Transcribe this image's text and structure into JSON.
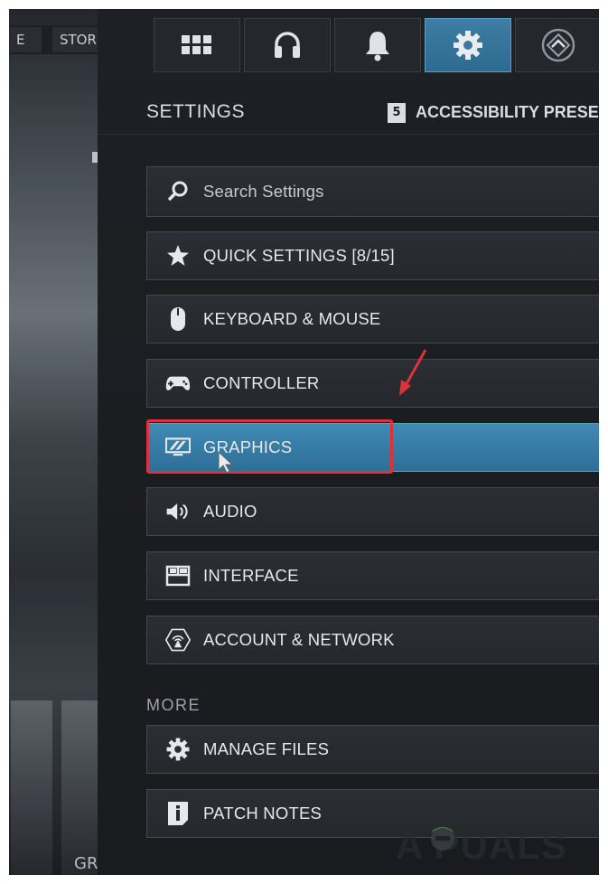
{
  "background": {
    "tabs": [
      "E",
      "STOR"
    ],
    "bottom_text": "GR"
  },
  "top_tabs": [
    {
      "icon": "grid-icon",
      "active": false
    },
    {
      "icon": "headset-icon",
      "active": false
    },
    {
      "icon": "bell-icon",
      "active": false
    },
    {
      "icon": "gear-icon",
      "active": true
    },
    {
      "icon": "rank-diamond-icon",
      "active": false
    }
  ],
  "header": {
    "title": "SETTINGS",
    "preset_key": "5",
    "preset_label": "ACCESSIBILITY PRESETS"
  },
  "search": {
    "placeholder": "Search Settings"
  },
  "menu": [
    {
      "label": "QUICK SETTINGS [8/15]",
      "icon": "star-icon"
    },
    {
      "label": "KEYBOARD & MOUSE",
      "icon": "mouse-icon"
    },
    {
      "label": "CONTROLLER",
      "icon": "gamepad-icon"
    },
    {
      "label": "GRAPHICS",
      "icon": "monitor-icon",
      "selected": true
    },
    {
      "label": "AUDIO",
      "icon": "speaker-icon"
    },
    {
      "label": "INTERFACE",
      "icon": "layout-icon"
    },
    {
      "label": "ACCOUNT & NETWORK",
      "icon": "network-icon"
    }
  ],
  "more": {
    "title": "MORE",
    "items": [
      {
        "label": "MANAGE FILES",
        "icon": "gear-icon"
      },
      {
        "label": "PATCH NOTES",
        "icon": "info-icon"
      }
    ]
  },
  "watermark": "A  PUALS",
  "colors": {
    "selected": "#3f8ab5",
    "highlight": "#e0303a",
    "arrow": "#e0303a"
  }
}
